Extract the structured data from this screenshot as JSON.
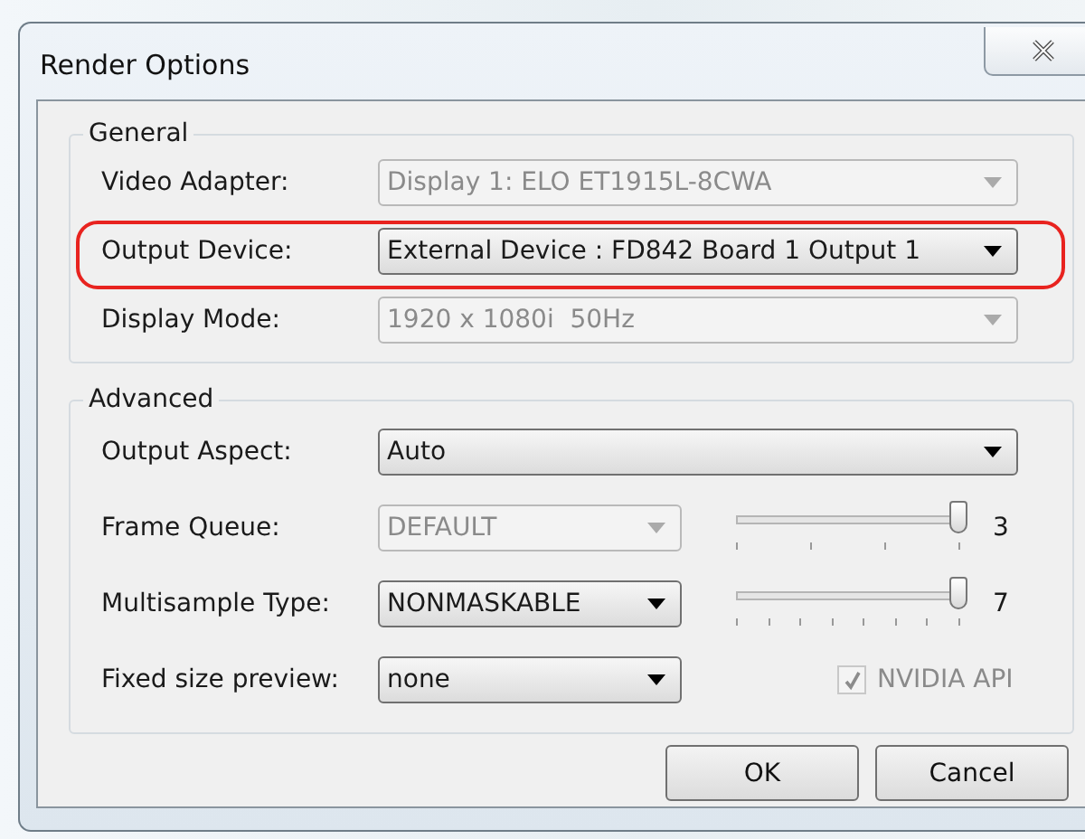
{
  "window": {
    "title": "Render Options"
  },
  "general": {
    "title": "General",
    "rows": [
      {
        "label": "Video Adapter:",
        "value": "Display 1: ELO ET1915L-8CWA",
        "disabled": true,
        "highlighted": false
      },
      {
        "label": "Output Device:",
        "value": "External Device : FD842 Board 1 Output 1",
        "disabled": false,
        "highlighted": true
      },
      {
        "label": "Display Mode:",
        "value": "1920 x 1080i  50Hz",
        "disabled": true,
        "highlighted": false
      }
    ]
  },
  "advanced": {
    "title": "Advanced",
    "rows": [
      {
        "kind": "wide",
        "label": "Output Aspect:",
        "value": "Auto",
        "disabled": false
      },
      {
        "kind": "slider",
        "label": "Frame Queue:",
        "value": "DEFAULT",
        "disabled": true,
        "slider": {
          "level": 1,
          "reading": "3"
        }
      },
      {
        "kind": "slider",
        "label": "Multisample Type:",
        "value": "NONMASKABLE",
        "disabled": false,
        "slider": {
          "level": 1,
          "reading": "7"
        }
      },
      {
        "kind": "checkbox",
        "label": "Fixed size preview:",
        "value": "none",
        "disabled": false,
        "checkbox": {
          "label": "NVIDIA API",
          "checked": true,
          "disabled": true
        }
      }
    ]
  },
  "buttons": [
    "OK",
    "Cancel"
  ]
}
